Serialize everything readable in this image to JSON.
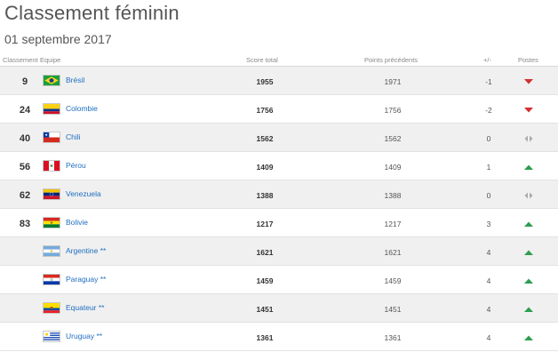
{
  "page": {
    "title": "Classement féminin",
    "date": "01 septembre 2017"
  },
  "headers": {
    "rank": "Classement",
    "team": "Equipe",
    "score": "Score total",
    "previous": "Points précédents",
    "diff": "+/-",
    "positions": "Postes"
  },
  "colors": {
    "up": "#2e9e4f",
    "down": "#d32f2f",
    "same": "#aaaaaa",
    "link": "#1f6fc1"
  },
  "rows": [
    {
      "rank": "9",
      "team": "Brésil",
      "flag": "brazil-flag-icon",
      "score": "1955",
      "previous": "1971",
      "diff": "-1",
      "trend": "down"
    },
    {
      "rank": "24",
      "team": "Colombie",
      "flag": "colombia-flag-icon",
      "score": "1756",
      "previous": "1756",
      "diff": "-2",
      "trend": "down"
    },
    {
      "rank": "40",
      "team": "Chili",
      "flag": "chile-flag-icon",
      "score": "1562",
      "previous": "1562",
      "diff": "0",
      "trend": "same"
    },
    {
      "rank": "56",
      "team": "Pérou",
      "flag": "peru-flag-icon",
      "score": "1409",
      "previous": "1409",
      "diff": "1",
      "trend": "up"
    },
    {
      "rank": "62",
      "team": "Venezuela",
      "flag": "venezuela-flag-icon",
      "score": "1388",
      "previous": "1388",
      "diff": "0",
      "trend": "same"
    },
    {
      "rank": "83",
      "team": "Bolivie",
      "flag": "bolivia-flag-icon",
      "score": "1217",
      "previous": "1217",
      "diff": "3",
      "trend": "up"
    },
    {
      "rank": "",
      "team": "Argentine **",
      "flag": "argentina-flag-icon",
      "score": "1621",
      "previous": "1621",
      "diff": "4",
      "trend": "up"
    },
    {
      "rank": "",
      "team": "Paraguay **",
      "flag": "paraguay-flag-icon",
      "score": "1459",
      "previous": "1459",
      "diff": "4",
      "trend": "up"
    },
    {
      "rank": "",
      "team": "Equateur **",
      "flag": "ecuador-flag-icon",
      "score": "1451",
      "previous": "1451",
      "diff": "4",
      "trend": "up"
    },
    {
      "rank": "",
      "team": "Uruguay **",
      "flag": "uruguay-flag-icon",
      "score": "1361",
      "previous": "1361",
      "diff": "4",
      "trend": "up"
    }
  ]
}
